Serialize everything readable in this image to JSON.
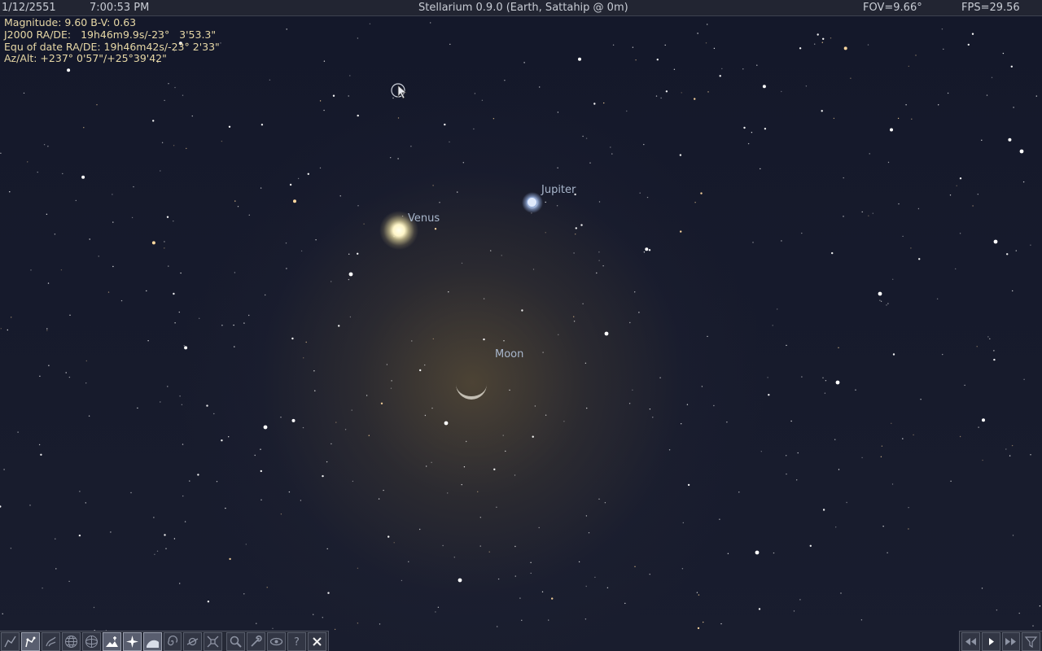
{
  "app": {
    "date": "1/12/2551",
    "time": "7:00:53 PM",
    "title": "Stellarium 0.9.0 (Earth, Sattahip @ 0m)",
    "fov": "FOV=9.66°",
    "fps": "FPS=29.56"
  },
  "object_info": {
    "magnitude": "Magnitude: 9.60 B-V: 0.63",
    "j2000": "J2000 RA/DE:   19h46m9.9s/-23°   3'53.3\"",
    "equ_of_date": "Equ of date RA/DE: 19h46m42s/-23° 2'33\"",
    "az_alt": "Az/Alt: +237° 0'57\"/+25°39'42\""
  },
  "sky_labels": {
    "venus": "Venus",
    "jupiter": "Jupiter",
    "moon": "Moon"
  },
  "toolbar": {
    "buttons": [
      {
        "icon": "constellation-lines-icon",
        "active": false
      },
      {
        "icon": "constellation-labels-icon",
        "active": true
      },
      {
        "icon": "constellation-art-icon",
        "active": false
      },
      {
        "icon": "equatorial-grid-icon",
        "active": false
      },
      {
        "icon": "azimuthal-grid-icon",
        "active": false
      },
      {
        "icon": "ground-icon",
        "active": true
      },
      {
        "icon": "cardinal-points-icon",
        "active": true
      },
      {
        "icon": "atmosphere-icon",
        "active": true
      },
      {
        "icon": "nebulae-icon",
        "active": false
      },
      {
        "icon": "planet-hints-icon",
        "active": false
      },
      {
        "icon": "equatorial-mount-icon",
        "active": false
      },
      {
        "icon": "search-icon",
        "active": false
      },
      {
        "icon": "configuration-icon",
        "active": false
      },
      {
        "icon": "night-mode-icon",
        "active": false
      },
      {
        "icon": "help-icon",
        "active": false
      },
      {
        "icon": "quit-icon",
        "active": false
      }
    ]
  },
  "timebar": {
    "buttons": [
      "rewind-icon",
      "play-icon",
      "fast-forward-icon",
      "real-time-icon"
    ]
  },
  "colors": {
    "sky": "#15192a",
    "info_text": "#e7d8a6",
    "label_text": "#a9b7cc"
  }
}
